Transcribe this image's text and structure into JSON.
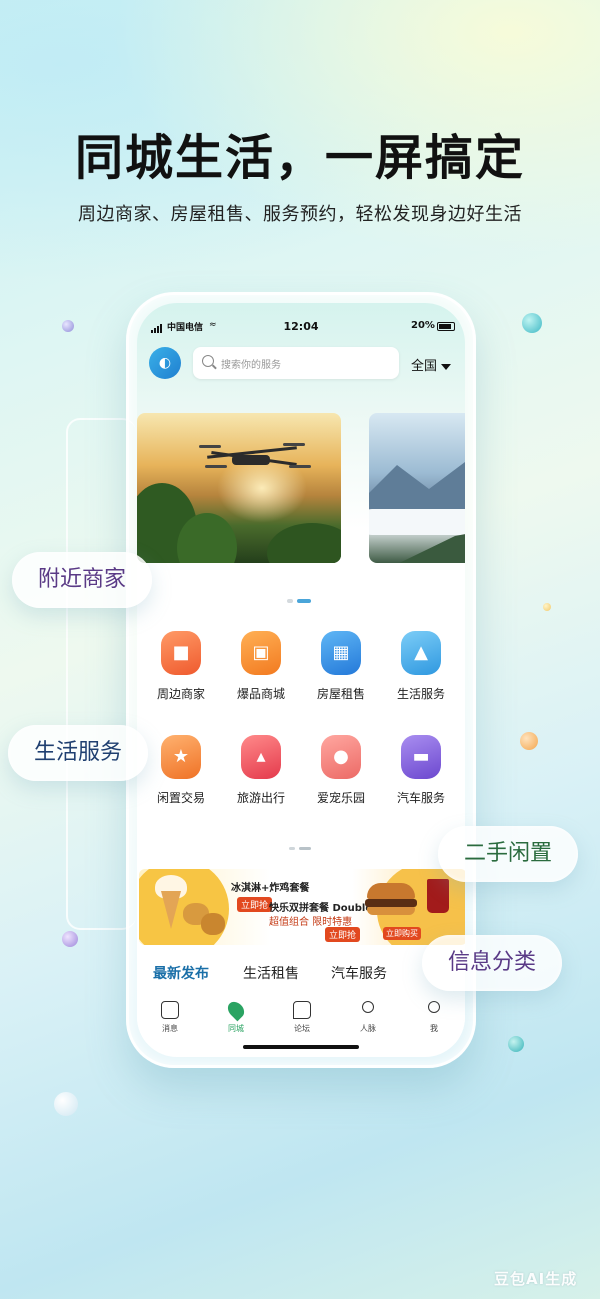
{
  "promo": {
    "headline": "同城生活，一屏搞定",
    "subline": "周边商家、房屋租售、服务预约，轻松发现身边好生活"
  },
  "statusbar": {
    "carrier": "中国电信",
    "time": "12:04",
    "battery_text": "20%",
    "battery_level": 0.2
  },
  "header": {
    "search_placeholder": "搜索你的服务",
    "city": "全国"
  },
  "categories": [
    {
      "label": "周边商家",
      "icon": "storefront-icon",
      "color": "#f26b3a"
    },
    {
      "label": "爆品商城",
      "icon": "shopping-bag-icon",
      "color": "#f58a2c"
    },
    {
      "label": "房屋租售",
      "icon": "building-icon",
      "color": "#2f8fe0"
    },
    {
      "label": "生活服务",
      "icon": "lamp-icon",
      "color": "#3aa5e6"
    },
    {
      "label": "闲置交易",
      "icon": "box-icon",
      "color": "#f5853a"
    },
    {
      "label": "旅游出行",
      "icon": "tent-icon",
      "color": "#ef4f5c"
    },
    {
      "label": "爱宠乐园",
      "icon": "dog-icon",
      "color": "#f07a76"
    },
    {
      "label": "汽车服务",
      "icon": "car-icon",
      "color": "#8a62d8"
    }
  ],
  "ad": {
    "line1": "冰淇淋+炸鸡套餐",
    "line2": "快乐双拼套餐 Double",
    "line3": "超值组合 限时特惠",
    "badge_left": "立即抢",
    "badge_right": "立即购买"
  },
  "tabs": [
    {
      "label": "最新发布",
      "active": true
    },
    {
      "label": "生活租售",
      "active": false
    },
    {
      "label": "汽车服务",
      "active": false
    }
  ],
  "nav": [
    {
      "label": "消息",
      "icon": "message-icon",
      "active": false
    },
    {
      "label": "同城",
      "icon": "location-pin-icon",
      "active": true
    },
    {
      "label": "论坛",
      "icon": "chat-icon",
      "active": false
    },
    {
      "label": "人脉",
      "icon": "contacts-icon",
      "active": false
    },
    {
      "label": "我",
      "icon": "profile-icon",
      "active": false
    }
  ],
  "chips": {
    "nearby": "附近商家",
    "life_service": "生活服务",
    "second_hand": "二手闲置",
    "info": "信息分类"
  },
  "colors": {
    "accent_blue": "#1a6fa8",
    "accent_green": "#2aa362",
    "chip_purple": "#5a3a86",
    "chip_navy": "#1f3f70",
    "chip_green": "#2a6b3e"
  },
  "watermark": "豆包AI生成"
}
